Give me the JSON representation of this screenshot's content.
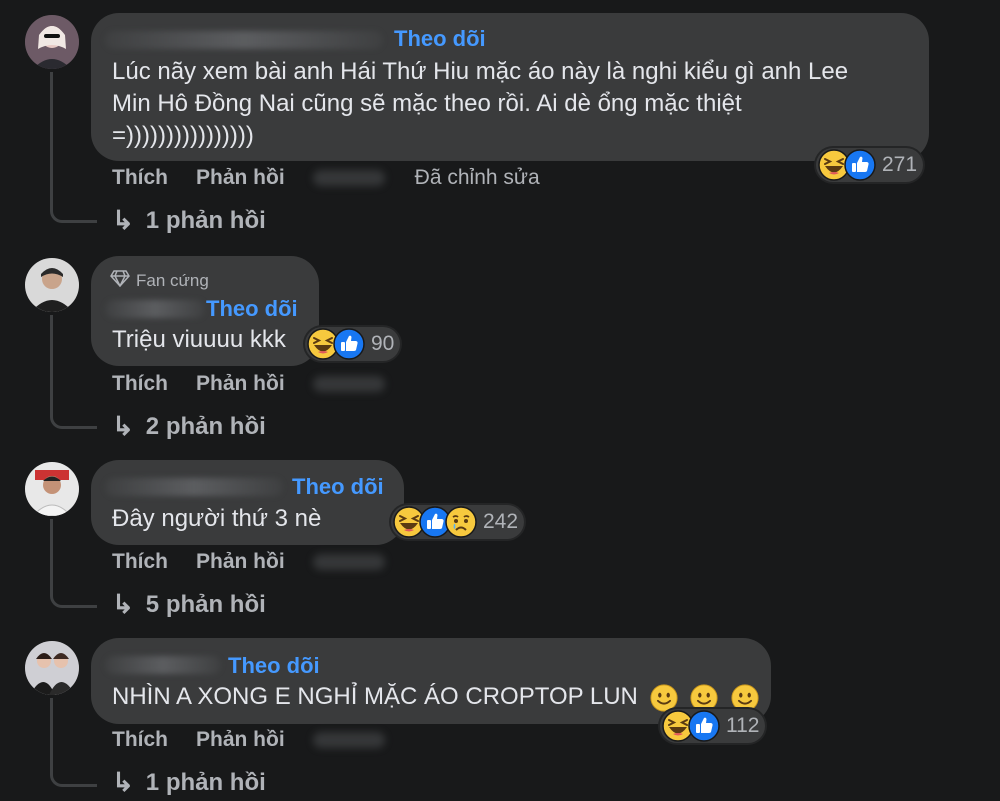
{
  "comments": [
    {
      "follow": "Theo dõi",
      "text_lines": [
        "Lúc nãy xem bài anh Hái Thứ Hiu mặc áo này là nghi kiểu gì anh Lee",
        "Min Hô Đồng Nai cũng sẽ mặc theo rồi. Ai dè ổng mặc thiệt",
        "=))))))))))))))))"
      ],
      "reaction_count": "271",
      "like": "Thích",
      "reply": "Phản hồi",
      "edited": "Đã chỉnh sửa",
      "replies": "1 phản hồi"
    },
    {
      "badge": "Fan cứng",
      "follow": "Theo dõi",
      "text": "Triệu viuuuu kkk",
      "reaction_count": "90",
      "like": "Thích",
      "reply": "Phản hồi",
      "replies": "2 phản hồi"
    },
    {
      "follow": "Theo dõi",
      "text": "Đây người thứ 3 nè",
      "reaction_count": "242",
      "like": "Thích",
      "reply": "Phản hồi",
      "replies": "5 phản hồi"
    },
    {
      "follow": "Theo dõi",
      "text": "NHÌN A XONG E NGHỈ MẶC ÁO CROPTOP LUN",
      "reaction_count": "112",
      "like": "Thích",
      "reply": "Phản hồi",
      "replies": "1 phản hồi"
    }
  ],
  "icons": {
    "reply_arrow": "reply-arrow-icon",
    "haha": "haha-reaction-icon",
    "like": "like-reaction-icon",
    "sad": "sad-reaction-icon",
    "smile": "smile-emoji-icon",
    "diamond": "diamond-badge-icon"
  },
  "colors": {
    "background": "#18191a",
    "bubble": "#3a3b3c",
    "follow": "#4599ff",
    "muted": "#b0b3b8",
    "like_blue": "#1877f2",
    "emoji_yellow": "#f7c93e"
  }
}
